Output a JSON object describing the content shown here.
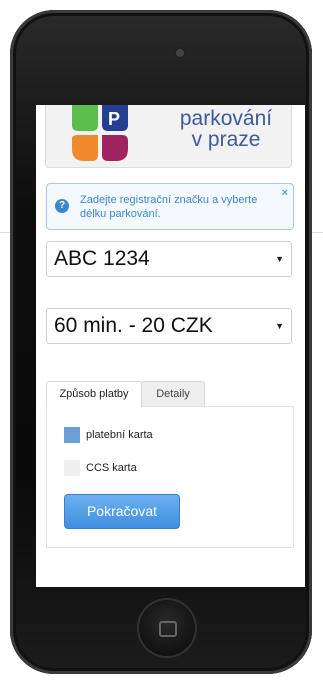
{
  "logo": {
    "line1": "parkování",
    "line2": "v praze",
    "letter": "P"
  },
  "alert": {
    "icon": "question-circle-icon",
    "text": "Zadejte registrační značku a vyberte délku parkování.",
    "close": "×"
  },
  "plate_select": {
    "value": "ABC 1234",
    "arrow": "▼"
  },
  "duration_select": {
    "value": "60 min. - 20 CZK",
    "arrow": "▼"
  },
  "tabs": [
    {
      "label": "Způsob platby"
    },
    {
      "label": "Detaily"
    }
  ],
  "payment": {
    "options": [
      {
        "label": "platební karta",
        "color": "#6b9fd8"
      },
      {
        "label": "CCS karta",
        "color": "#eeeeee"
      }
    ],
    "continue_label": "Pokračovat"
  },
  "colors": {
    "accent": "#3f8fe0",
    "logo_blue": "#3d5a9b",
    "logo_green": "#5bbd4a",
    "logo_orange": "#f08a2e",
    "logo_purple": "#a0245f",
    "logo_navy": "#233f8f"
  }
}
